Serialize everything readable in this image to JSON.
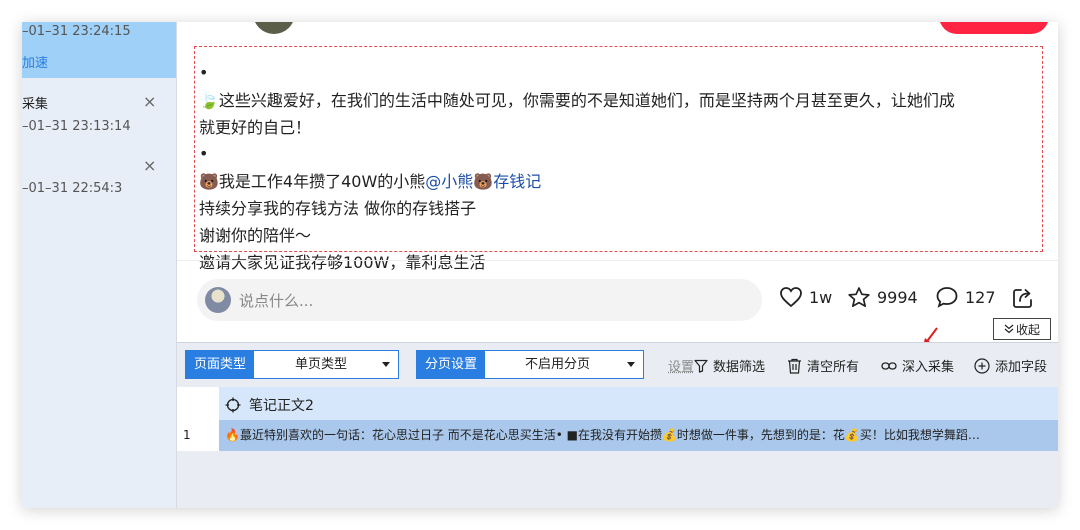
{
  "sidebar": {
    "items": [
      {
        "time": "–01–31 23:24:15",
        "tag": "加速"
      },
      {
        "title": "采集",
        "time": "–01–31 23:13:14",
        "close": "×"
      },
      {
        "time": "–01–31 22:54:3",
        "close": "×"
      }
    ]
  },
  "note": {
    "bullet": "•",
    "line1": "这些兴趣爱好，在我们的生活中随处可见，你需要的不是知道她们，而是坚持两个月甚至更久，让她们成",
    "line1_icon": "🍃",
    "line2": "就更好的自己！",
    "line3_prefix": "我是工作4年攒了40W的小熊",
    "line3_icon": "🐻",
    "line3_mention_a": "@小熊",
    "line3_mention_icon": "🐻",
    "line3_mention_b": "存钱记",
    "line4": "持续分享我的存钱方法 做你的存钱搭子",
    "line5": "谢谢你的陪伴～",
    "line6": "邀请大家见证我存够100W，靠利息生活"
  },
  "engagement": {
    "comment_placeholder": "说点什么...",
    "likes": "1w",
    "stars": "9994",
    "comments": "127"
  },
  "collapse_label": "收起",
  "toolbar": {
    "page_type_label": "页面类型",
    "page_type_value": "单页类型",
    "paging_label": "分页设置",
    "paging_value": "不启用分页",
    "settings_label": "设置",
    "data_filter": "数据筛选",
    "clear_all": "清空所有",
    "deep_collect": "深入采集",
    "add_field": "添加字段"
  },
  "table": {
    "columns": [
      "笔记正文2"
    ],
    "rows": [
      {
        "index": "1",
        "cell": "🔥蕞近特别喜欢的一句话：花心思过日子 而不是花心思买生活• ■在我没有开始攒💰时想做一件事，先想到的是：花💰买！比如我想学舞蹈…"
      }
    ]
  },
  "colors": {
    "accent": "#2a7de1",
    "brand_red": "#ff2442",
    "selection_row": "#a9c8ec",
    "header_row": "#d6e6fb",
    "active_sidebar": "#9ed0f8"
  }
}
